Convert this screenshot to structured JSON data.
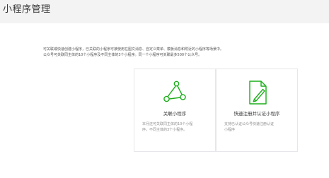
{
  "header": {
    "title": "小程序管理"
  },
  "intro": {
    "lines": [
      "可关联或快速创建小程序，已关联的小程序可被使用在图文消息、自定义菜单、模板消息和附近的小程序等场景中。",
      "公众号可关联同主体的10个小程序及不同主体的3个小程序。同一个小程序可关联最多500个公众号。"
    ]
  },
  "cards": [
    {
      "icon": "link-nodes-icon",
      "title": "关联小程序",
      "desc": [
        "本月还可关联同主体的10个小程",
        "序，不同主体的3个小程序。"
      ]
    },
    {
      "icon": "document-edit-icon",
      "title": "快速注册并认证小程序",
      "desc": [
        "支持已认证公众号快速注册认证",
        "小程序"
      ]
    }
  ],
  "colors": {
    "accent": "#1aad19",
    "border": "#e7e7eb",
    "background": "#f3f3f4"
  }
}
